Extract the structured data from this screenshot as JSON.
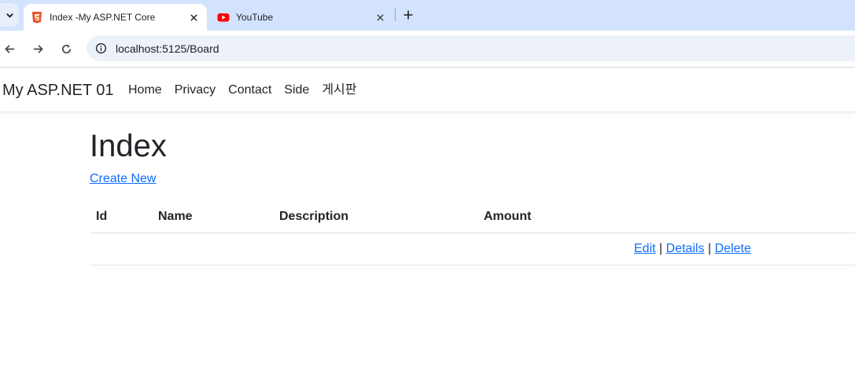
{
  "browser": {
    "tabs": [
      {
        "title": "Index -My ASP.NET Core",
        "favicon": "html5-icon",
        "active": true
      },
      {
        "title": "YouTube",
        "favicon": "youtube-icon",
        "active": false
      }
    ],
    "address_bar": {
      "url": "localhost:5125/Board"
    }
  },
  "navbar": {
    "brand": "My ASP.NET 01",
    "links": [
      "Home",
      "Privacy",
      "Contact",
      "Side",
      "게시판"
    ]
  },
  "page": {
    "title": "Index",
    "create_link": "Create New"
  },
  "table": {
    "columns": [
      "Id",
      "Name",
      "Description",
      "Amount"
    ],
    "row_actions": {
      "edit": "Edit",
      "details": "Details",
      "delete": "Delete",
      "separator": "|"
    }
  },
  "colors": {
    "link": "#0d6efd",
    "tabbar": "#d3e3fd",
    "html5": "#e44d26",
    "youtube": "#ff0000"
  }
}
